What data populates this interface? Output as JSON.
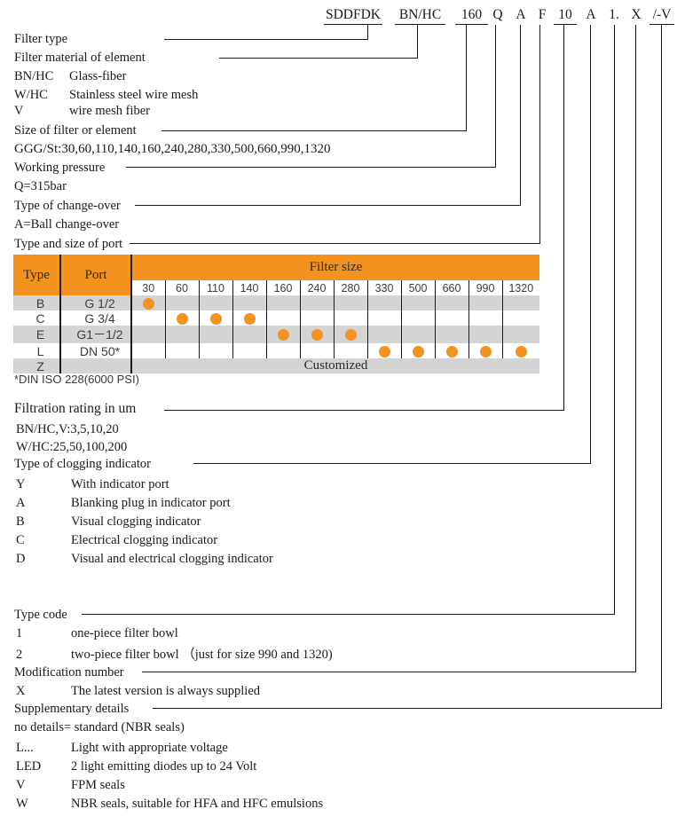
{
  "code_string": {
    "segments": [
      {
        "text": "SDDFDK",
        "underline": true
      },
      {
        "text": "BN/HC",
        "underline": true
      },
      {
        "text": "160",
        "underline": true
      },
      {
        "text": "Q",
        "underline": false
      },
      {
        "text": "A",
        "underline": false
      },
      {
        "text": "F",
        "underline": false
      },
      {
        "text": "10",
        "underline": true
      },
      {
        "text": "A",
        "underline": false
      },
      {
        "text": "1.",
        "underline": false
      },
      {
        "text": "X",
        "underline": false
      },
      {
        "text": "/-V",
        "underline": true
      }
    ]
  },
  "legend": {
    "filter_type": "Filter type",
    "filter_material": "Filter material of element",
    "materials": [
      {
        "code": "BN/HC",
        "desc": "Glass-fiber"
      },
      {
        "code": "W/HC",
        "desc": "Stainless steel wire mesh"
      },
      {
        "code": "V",
        "desc": "wire mesh fiber"
      }
    ],
    "size_of_filter": "Size of filter or element",
    "sizes_line": "GGG/St:30,60,110,140,160,240,280,330,500,660,990,1320",
    "working_pressure": "Working pressure",
    "working_pressure_value": "Q=315bar",
    "type_of_changeover": "Type of change-over",
    "changeover_value": "A=Ball change-over",
    "type_and_size_of_port": "Type and size of port",
    "din_note": "*DIN ISO 228(6000 PSI)",
    "filtration_rating": "Filtration rating in um",
    "filtration_lines": [
      "BN/HC,V:3,5,10,20",
      "W/HC:25,50,100,200"
    ],
    "type_of_clogging_indicator": "Type of clogging indicator",
    "clogging_options": [
      {
        "code": "Y",
        "desc": "With indicator port"
      },
      {
        "code": "A",
        "desc": "Blanking plug in indicator port"
      },
      {
        "code": "B",
        "desc": "Visual clogging indicator"
      },
      {
        "code": "C",
        "desc": "Electrical clogging indicator"
      },
      {
        "code": "D",
        "desc": "Visual and electrical clogging indicator"
      }
    ],
    "type_code": "Type code",
    "type_code_options": [
      {
        "code": "1",
        "desc": "one-piece filter bowl"
      },
      {
        "code": "2",
        "desc": "two-piece filter bowl （just for size 990 and 1320)"
      }
    ],
    "modification_number": "Modification number",
    "modification_options": [
      {
        "code": "X",
        "desc": "The latest version is always supplied"
      }
    ],
    "supplementary_details": "Supplementary details",
    "supplementary_no_details": "no details= standard (NBR seals)",
    "supplementary_options": [
      {
        "code": "L...",
        "desc": "Light with appropriate voltage"
      },
      {
        "code": "LED",
        "desc": "2 light emitting diodes up to 24 Volt"
      },
      {
        "code": "V",
        "desc": "FPM seals"
      },
      {
        "code": "W",
        "desc": "NBR seals, suitable for HFA and HFC emulsions"
      }
    ]
  },
  "table": {
    "header_type": "Type",
    "header_port": "Port",
    "header_filter_size": "Filter size",
    "sizes": [
      "30",
      "60",
      "110",
      "140",
      "160",
      "240",
      "280",
      "330",
      "500",
      "660",
      "990",
      "1320"
    ],
    "customized_label": "Customized",
    "rows": [
      {
        "type": "B",
        "port": "G 1/2",
        "marks": [
          "30"
        ]
      },
      {
        "type": "C",
        "port": "G 3/4",
        "marks": [
          "60",
          "110",
          "140"
        ]
      },
      {
        "type": "E",
        "port": "G1－1/2",
        "marks": [
          "160",
          "240",
          "280"
        ]
      },
      {
        "type": "L",
        "port": "DN 50*",
        "marks": [
          "330",
          "500",
          "660",
          "990",
          "1320"
        ]
      },
      {
        "type": "Z",
        "port": "",
        "marks": [],
        "customized": true
      }
    ]
  },
  "colors": {
    "accent_orange": "#F3921F",
    "row_shade": "#d4d4d4",
    "line": "#1a1a1a"
  }
}
